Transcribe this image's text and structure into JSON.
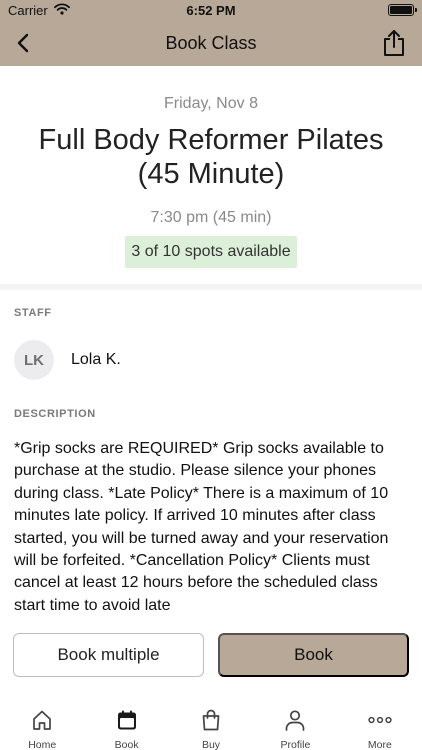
{
  "status_bar": {
    "carrier": "Carrier",
    "time": "6:52 PM"
  },
  "nav": {
    "title": "Book Class"
  },
  "class": {
    "date": "Friday, Nov 8",
    "title": "Full Body Reformer Pilates (45 Minute)",
    "time": "7:30 pm (45 min)",
    "spots": "3 of 10 spots available"
  },
  "staff": {
    "label": "STAFF",
    "initials": "LK",
    "name": "Lola K."
  },
  "description": {
    "label": "DESCRIPTION",
    "text": "*Grip socks are REQUIRED*   Grip socks available to purchase at the studio.   Please silence your phones during class.   *Late Policy* There is a maximum of 10 minutes late policy. If arrived 10 minutes after class started, you will be turned away and your reservation will be forfeited.   *Cancellation Policy* Clients must cancel at least 12 hours before the scheduled class start time to avoid late"
  },
  "actions": {
    "book_multiple": "Book multiple",
    "book": "Book"
  },
  "tabs": [
    {
      "label": "Home",
      "icon": "home-icon"
    },
    {
      "label": "Book",
      "icon": "calendar-icon"
    },
    {
      "label": "Buy",
      "icon": "shopping-bag-icon"
    },
    {
      "label": "Profile",
      "icon": "person-icon"
    },
    {
      "label": "More",
      "icon": "more-icon"
    }
  ],
  "colors": {
    "brand": "#b7a898",
    "spots_bg": "#dcefd8",
    "muted_text": "#8a8a8a"
  }
}
